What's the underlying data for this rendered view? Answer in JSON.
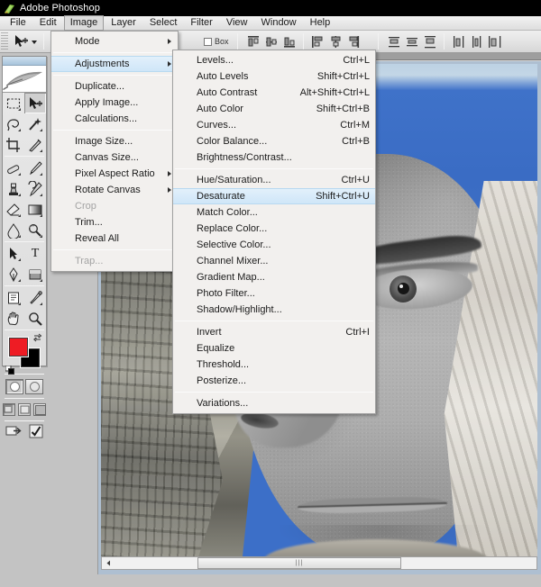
{
  "window": {
    "title": "Adobe Photoshop",
    "logo_icon": "photoshop-feather-icon"
  },
  "menubar": {
    "items": [
      {
        "label": "File",
        "open": false
      },
      {
        "label": "Edit",
        "open": false
      },
      {
        "label": "Image",
        "open": true
      },
      {
        "label": "Layer",
        "open": false
      },
      {
        "label": "Select",
        "open": false
      },
      {
        "label": "Filter",
        "open": false
      },
      {
        "label": "View",
        "open": false
      },
      {
        "label": "Window",
        "open": false
      },
      {
        "label": "Help",
        "open": false
      }
    ]
  },
  "options_bar": {
    "tool_icon": "move-tool-icon",
    "preset_caret": "chevron-down-icon",
    "bounding_box_label": "Box",
    "align_buttons": [
      "align-top-edges-icon",
      "align-vertical-centers-icon",
      "align-bottom-edges-icon",
      "align-left-edges-icon",
      "align-horizontal-centers-icon",
      "align-right-edges-icon"
    ],
    "distribute_buttons": [
      "distribute-top-edges-icon",
      "distribute-vertical-centers-icon",
      "distribute-bottom-edges-icon",
      "distribute-left-edges-icon",
      "distribute-horizontal-centers-icon",
      "distribute-right-edges-icon"
    ]
  },
  "toolbox": {
    "logo_icon": "photoshop-feather-icon",
    "tools": [
      {
        "icon": "rectangular-marquee-tool-icon",
        "selected": false,
        "has_submenu": true
      },
      {
        "icon": "move-tool-icon",
        "selected": true,
        "has_submenu": false
      },
      {
        "icon": "lasso-tool-icon",
        "selected": false,
        "has_submenu": true
      },
      {
        "icon": "magic-wand-tool-icon",
        "selected": false,
        "has_submenu": true
      },
      {
        "icon": "crop-tool-icon",
        "selected": false,
        "has_submenu": false
      },
      {
        "icon": "slice-tool-icon",
        "selected": false,
        "has_submenu": true
      },
      {
        "icon": "healing-brush-tool-icon",
        "selected": false,
        "has_submenu": true
      },
      {
        "icon": "brush-tool-icon",
        "selected": false,
        "has_submenu": true
      },
      {
        "icon": "clone-stamp-tool-icon",
        "selected": false,
        "has_submenu": true
      },
      {
        "icon": "history-brush-tool-icon",
        "selected": false,
        "has_submenu": true
      },
      {
        "icon": "eraser-tool-icon",
        "selected": false,
        "has_submenu": true
      },
      {
        "icon": "gradient-tool-icon",
        "selected": false,
        "has_submenu": true
      },
      {
        "icon": "blur-tool-icon",
        "selected": false,
        "has_submenu": true
      },
      {
        "icon": "dodge-tool-icon",
        "selected": false,
        "has_submenu": true
      },
      {
        "icon": "path-selection-tool-icon",
        "selected": false,
        "has_submenu": true
      },
      {
        "icon": "type-tool-icon",
        "selected": false,
        "has_submenu": true
      },
      {
        "icon": "pen-tool-icon",
        "selected": false,
        "has_submenu": true
      },
      {
        "icon": "rectangle-shape-tool-icon",
        "selected": false,
        "has_submenu": true
      },
      {
        "icon": "notes-tool-icon",
        "selected": false,
        "has_submenu": true
      },
      {
        "icon": "eyedropper-tool-icon",
        "selected": false,
        "has_submenu": true
      },
      {
        "icon": "hand-tool-icon",
        "selected": false,
        "has_submenu": false
      },
      {
        "icon": "zoom-tool-icon",
        "selected": false,
        "has_submenu": false
      }
    ],
    "colors": {
      "foreground": "#ee1c24",
      "background": "#000000",
      "swap_icon": "swap-colors-icon",
      "default_icon": "default-colors-icon"
    },
    "mask_modes": [
      {
        "icon": "standard-mode-icon",
        "selected": true
      },
      {
        "icon": "quick-mask-mode-icon",
        "selected": false
      }
    ],
    "screen_modes": [
      {
        "icon": "standard-screen-mode-icon",
        "selected": true
      },
      {
        "icon": "full-screen-with-menubar-icon",
        "selected": false
      },
      {
        "icon": "full-screen-mode-icon",
        "selected": false
      }
    ],
    "jump_buttons": [
      {
        "icon": "jump-to-imageready-icon"
      },
      {
        "icon": "commit-checkmark-icon"
      }
    ]
  },
  "image_menu": {
    "items": [
      {
        "label": "Mode",
        "accel": "",
        "submenu": true,
        "disabled": false,
        "highlighted": false
      },
      {
        "sep": true
      },
      {
        "label": "Adjustments",
        "accel": "",
        "submenu": true,
        "disabled": false,
        "highlighted": true
      },
      {
        "sep": true
      },
      {
        "label": "Duplicate...",
        "accel": "",
        "submenu": false,
        "disabled": false,
        "highlighted": false
      },
      {
        "label": "Apply Image...",
        "accel": "",
        "submenu": false,
        "disabled": false,
        "highlighted": false
      },
      {
        "label": "Calculations...",
        "accel": "",
        "submenu": false,
        "disabled": false,
        "highlighted": false
      },
      {
        "sep": true
      },
      {
        "label": "Image Size...",
        "accel": "",
        "submenu": false,
        "disabled": false,
        "highlighted": false
      },
      {
        "label": "Canvas Size...",
        "accel": "",
        "submenu": false,
        "disabled": false,
        "highlighted": false
      },
      {
        "label": "Pixel Aspect Ratio",
        "accel": "",
        "submenu": true,
        "disabled": false,
        "highlighted": false
      },
      {
        "label": "Rotate Canvas",
        "accel": "",
        "submenu": true,
        "disabled": false,
        "highlighted": false
      },
      {
        "label": "Crop",
        "accel": "",
        "submenu": false,
        "disabled": true,
        "highlighted": false
      },
      {
        "label": "Trim...",
        "accel": "",
        "submenu": false,
        "disabled": false,
        "highlighted": false
      },
      {
        "label": "Reveal All",
        "accel": "",
        "submenu": false,
        "disabled": false,
        "highlighted": false
      },
      {
        "sep": true
      },
      {
        "label": "Trap...",
        "accel": "",
        "submenu": false,
        "disabled": true,
        "highlighted": false
      }
    ]
  },
  "adjustments_submenu": {
    "items": [
      {
        "label": "Levels...",
        "accel": "Ctrl+L",
        "highlighted": false
      },
      {
        "label": "Auto Levels",
        "accel": "Shift+Ctrl+L",
        "highlighted": false
      },
      {
        "label": "Auto Contrast",
        "accel": "Alt+Shift+Ctrl+L",
        "highlighted": false
      },
      {
        "label": "Auto Color",
        "accel": "Shift+Ctrl+B",
        "highlighted": false
      },
      {
        "label": "Curves...",
        "accel": "Ctrl+M",
        "highlighted": false
      },
      {
        "label": "Color Balance...",
        "accel": "Ctrl+B",
        "highlighted": false
      },
      {
        "label": "Brightness/Contrast...",
        "accel": "",
        "highlighted": false
      },
      {
        "sep": true
      },
      {
        "label": "Hue/Saturation...",
        "accel": "Ctrl+U",
        "highlighted": false
      },
      {
        "label": "Desaturate",
        "accel": "Shift+Ctrl+U",
        "highlighted": true
      },
      {
        "label": "Match Color...",
        "accel": "",
        "highlighted": false
      },
      {
        "label": "Replace Color...",
        "accel": "",
        "highlighted": false
      },
      {
        "label": "Selective Color...",
        "accel": "",
        "highlighted": false
      },
      {
        "label": "Channel Mixer...",
        "accel": "",
        "highlighted": false
      },
      {
        "label": "Gradient Map...",
        "accel": "",
        "highlighted": false
      },
      {
        "label": "Photo Filter...",
        "accel": "",
        "highlighted": false
      },
      {
        "label": "Shadow/Highlight...",
        "accel": "",
        "highlighted": false
      },
      {
        "sep": true
      },
      {
        "label": "Invert",
        "accel": "Ctrl+I",
        "highlighted": false
      },
      {
        "label": "Equalize",
        "accel": "",
        "highlighted": false
      },
      {
        "label": "Threshold...",
        "accel": "",
        "highlighted": false
      },
      {
        "label": "Posterize...",
        "accel": "",
        "highlighted": false
      },
      {
        "sep": true
      },
      {
        "label": "Variations...",
        "accel": "",
        "highlighted": false
      }
    ]
  },
  "document": {
    "scrollbar": {
      "left_arrow_icon": "scroll-left-arrow-icon",
      "thumb_grip_icon": "scroll-thumb-grip-icon",
      "thumb_grip_glyph": "|||"
    },
    "image_description": "Grayscale portrait of a man's face composited over a color photo of a stone rock face"
  },
  "colors": {
    "title_bar_bg": "#000000",
    "menu_bg": "#f2f0ee",
    "highlight": "#cfe6f8",
    "app_bg": "#c3c3c3",
    "sky_blue": "#3f72c9",
    "foreground_swatch": "#ee1c24"
  }
}
